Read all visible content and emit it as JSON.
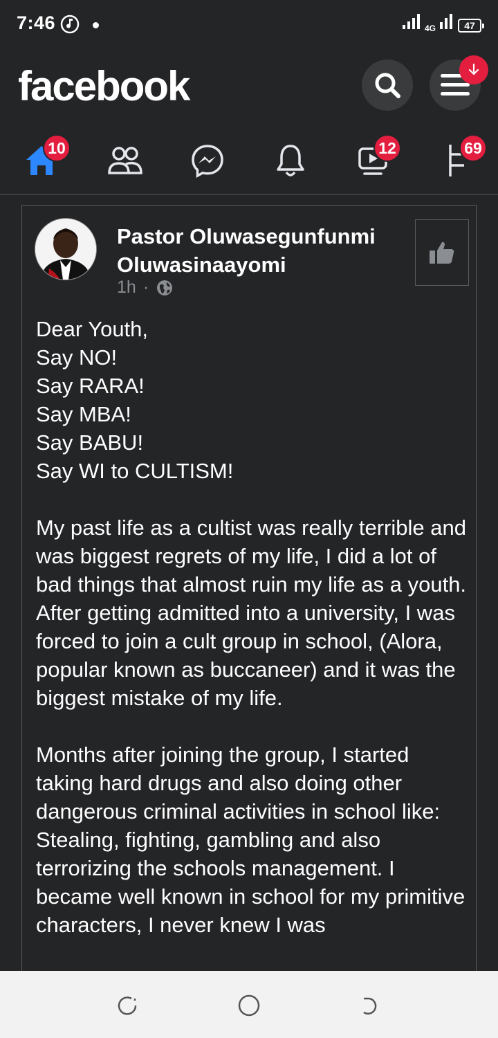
{
  "status_bar": {
    "time": "7:46",
    "network": "4G",
    "battery": "47"
  },
  "header": {
    "brand": "facebook",
    "search_icon": "search-icon",
    "menu_icon": "hamburger-menu-icon",
    "download_icon": "download-arrow-icon",
    "accent_color": "#e41e3f"
  },
  "nav": {
    "tabs": [
      {
        "name": "home",
        "icon": "home-icon",
        "badge": "10",
        "active": true
      },
      {
        "name": "friends",
        "icon": "friends-icon",
        "badge": ""
      },
      {
        "name": "messenger",
        "icon": "messenger-icon",
        "badge": ""
      },
      {
        "name": "notifications",
        "icon": "bell-icon",
        "badge": ""
      },
      {
        "name": "watch",
        "icon": "video-icon",
        "badge": "12"
      },
      {
        "name": "marketplace",
        "icon": "flag-icon",
        "badge": "69"
      }
    ],
    "active_color": "#2d88ff"
  },
  "post": {
    "author": "Pastor Oluwasegunfunmi Oluwasinaayomi",
    "time": "1h",
    "separator": "·",
    "privacy_icon": "globe-icon",
    "text": "Dear Youth,\nSay NO!\nSay RARA!\nSay MBA!\nSay BABU!\nSay WI to CULTISM!\n\nMy past life as a cultist was really terrible and was biggest regrets of my life, I did a lot of bad things that almost ruin my life as a youth. After getting admitted into a university, I was forced to join a cult group in school, (Alora, popular known as buccaneer) and it was the biggest mistake of my life.\n\nMonths after joining the group, I started taking hard drugs and also doing other dangerous criminal activities in school like: Stealing, fighting, gambling and also terrorizing the schools management. I became well known in school for my primitive characters, I never knew I was"
  },
  "system_nav": {
    "recents_icon": "recents-icon",
    "home_icon": "home-circle-icon",
    "back_icon": "back-icon"
  }
}
